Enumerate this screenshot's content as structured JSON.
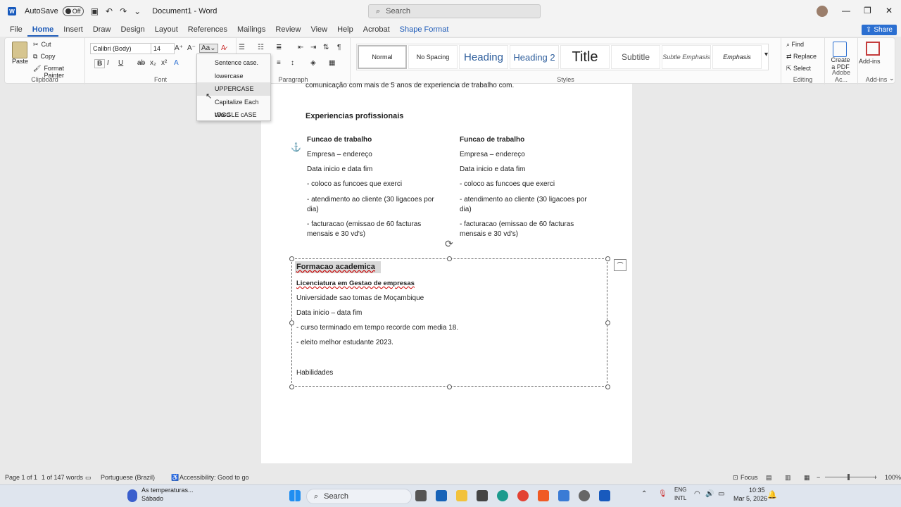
{
  "titlebar": {
    "autosave_label": "AutoSave",
    "autosave_state": "Off",
    "doc_title": "Document1 - Word",
    "search_placeholder": "Search"
  },
  "menu": {
    "items": [
      "File",
      "Home",
      "Insert",
      "Draw",
      "Design",
      "Layout",
      "References",
      "Mailings",
      "Review",
      "View",
      "Help",
      "Acrobat",
      "Shape Format"
    ],
    "active": "Home",
    "share_label": "Share"
  },
  "ribbon": {
    "clipboard": {
      "paste": "Paste",
      "cut": "Cut",
      "copy": "Copy",
      "format_painter": "Format Painter",
      "label": "Clipboard"
    },
    "font": {
      "family": "Calibri (Body)",
      "size": "14",
      "label": "Font"
    },
    "paragraph": {
      "label": "Paragraph"
    },
    "styles": {
      "items": [
        "Normal",
        "No Spacing",
        "Heading",
        "Heading 2",
        "Title",
        "Subtitle",
        "Subtle Emphasis",
        "Emphasis"
      ],
      "label": "Styles"
    },
    "editing": {
      "find": "Find",
      "replace": "Replace",
      "select": "Select",
      "label": "Editing"
    },
    "adobe": {
      "create": "Create",
      "pdf": "a PDF",
      "label": "Adobe Ac..."
    },
    "addins": {
      "title": "Add-ins",
      "label": "Add-ins"
    }
  },
  "change_case_menu": {
    "items": [
      "Sentence case.",
      "lowercase",
      "UPPERCASE",
      "Capitalize Each Word",
      "tOGGLE cASE"
    ]
  },
  "document": {
    "intro_line": "comunicação  com mais de 5 anos de experiencia de trabalho com.",
    "section_title": "Experiencias profissionais",
    "columns": [
      {
        "role": "Funcao de trabalho",
        "company": "Empresa – endereço",
        "dates": "Data inicio e data fim",
        "bullet1": "- coloco as funcoes que exerci",
        "bullet2": "- atendimento ao cliente (30 ligacoes por dia)",
        "bullet3": "- facturacao (emissao de 60 facturas mensais e 30 vd's)"
      },
      {
        "role": "Funcao de trabalho",
        "company": "Empresa – endereço",
        "dates": "Data inicio e data fim",
        "bullet1": "- coloco as funcoes que exerci",
        "bullet2": "- atendimento ao cliente (30 ligacoes por dia)",
        "bullet3": "- facturacao (emissao de 60 facturas mensais e 30 vd's)"
      }
    ],
    "textbox": {
      "title": "Formacao academica",
      "degree": "Licenciatura em Gestao de empresas",
      "university": "Universidade sao tomas de Moçambique",
      "dates": "Data inicio – data fim",
      "line1": "- curso terminado em tempo recorde com media 18.",
      "line2": "- eleito melhor estudante 2023.",
      "skills": "Habilidades"
    }
  },
  "statusbar": {
    "page": "Page 1 of 1",
    "words": "1 of 147 words",
    "language": "Portuguese (Brazil)",
    "accessibility": "Accessibility: Good to go",
    "focus": "Focus",
    "zoom": "100%"
  },
  "taskbar": {
    "weather_title": "As temperaturas...",
    "weather_sub": "Sábado",
    "search": "Search",
    "lang": "ENG",
    "layout": "INTL",
    "time": "10:35",
    "date": "Mar 5, 2026"
  }
}
